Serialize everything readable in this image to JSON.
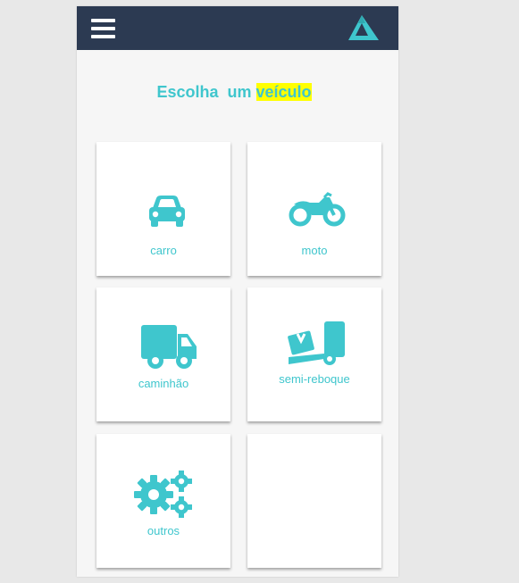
{
  "header": {
    "menu_icon": "hamburger-menu-icon",
    "logo_icon": "triangle-logo-icon"
  },
  "title": {
    "prefix": "Escolha  um ",
    "highlight": "veículo"
  },
  "vehicles": [
    {
      "label": "carro",
      "icon": "car-icon"
    },
    {
      "label": "moto",
      "icon": "motorcycle-icon"
    },
    {
      "label": "caminhão",
      "icon": "truck-icon"
    },
    {
      "label": "semi-reboque",
      "icon": "semi-trailer-icon"
    },
    {
      "label": "outros",
      "icon": "gears-icon"
    },
    {
      "label": "",
      "icon": ""
    }
  ],
  "colors": {
    "accent": "#3fc6cd",
    "header_bg": "#2c3a52",
    "highlight": "#ffff00"
  }
}
